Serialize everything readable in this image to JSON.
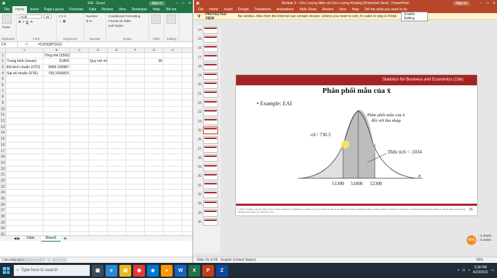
{
  "excel": {
    "title": "EAI - Excel",
    "signin": "Sign in",
    "tabs": [
      "File",
      "Home",
      "Insert",
      "Page Layout",
      "Formulas",
      "Data",
      "Review",
      "View",
      "Developer",
      "Help",
      "Tell me"
    ],
    "ribbon": {
      "paste": "Paste",
      "clipboard": "Clipboard",
      "font_name": "Arial",
      "font_size": "10",
      "font_group": "Font",
      "alignment": "Alignment",
      "number_format": "Number",
      "number_group": "Number",
      "conditional": "Conditional Formatting",
      "format_table": "Format as Table",
      "cell_styles": "Cell Styles",
      "styles_group": "Styles",
      "cells": "Cells",
      "editing": "Editing"
    },
    "namebox": "C4",
    "formula": "=C3/SQRT(G2)",
    "fx": "fx",
    "columns": [
      "A",
      "B",
      "C",
      "D",
      "E",
      "F",
      "G",
      "H"
    ],
    "rows": [
      [
        "1",
        "",
        "Tổng thể (2500)",
        "",
        "",
        "",
        "",
        "",
        ""
      ],
      [
        "2",
        "Trung bình (mean)",
        "51800",
        "",
        "Quy mô mẫu",
        "",
        "",
        "30",
        ""
      ],
      [
        "3",
        "Độ lệch chuẩn (STD)",
        "3999.199987",
        "",
        "",
        "",
        "",
        "",
        ""
      ],
      [
        "4",
        "Sai số chuẩn (STE)",
        "730.1506815",
        "",
        "",
        "",
        "",
        "",
        ""
      ],
      [
        "5",
        "",
        "",
        "",
        "",
        "",
        "",
        "",
        ""
      ],
      [
        "6",
        "",
        "",
        "",
        "",
        "",
        "",
        "",
        ""
      ],
      [
        "7",
        "",
        "",
        "",
        "",
        "",
        "",
        "",
        ""
      ],
      [
        "8",
        "",
        "",
        "",
        "",
        "",
        "",
        "",
        ""
      ],
      [
        "9",
        "",
        "",
        "",
        "",
        "",
        "",
        "",
        ""
      ],
      [
        "10",
        "",
        "",
        "",
        "",
        "",
        "",
        "",
        ""
      ],
      [
        "11",
        "",
        "",
        "",
        "",
        "",
        "",
        "",
        ""
      ],
      [
        "12",
        "",
        "",
        "",
        "",
        "",
        "",
        "",
        ""
      ],
      [
        "13",
        "",
        "",
        "",
        "",
        "",
        "",
        "",
        ""
      ],
      [
        "14",
        "",
        "",
        "",
        "",
        "",
        "",
        "",
        ""
      ],
      [
        "15",
        "",
        "",
        "",
        "",
        "",
        "",
        "",
        ""
      ],
      [
        "16",
        "",
        "",
        "",
        "",
        "",
        "",
        "",
        ""
      ],
      [
        "17",
        "",
        "",
        "",
        "",
        "",
        "",
        "",
        ""
      ],
      [
        "18",
        "",
        "",
        "",
        "",
        "",
        "",
        "",
        ""
      ],
      [
        "19",
        "",
        "",
        "",
        "",
        "",
        "",
        "",
        ""
      ],
      [
        "20",
        "",
        "",
        "",
        "",
        "",
        "",
        "",
        ""
      ],
      [
        "21",
        "",
        "",
        "",
        "",
        "",
        "",
        "",
        ""
      ],
      [
        "22",
        "",
        "",
        "",
        "",
        "",
        "",
        "",
        ""
      ],
      [
        "23",
        "",
        "",
        "",
        "",
        "",
        "",
        "",
        ""
      ],
      [
        "24",
        "",
        "",
        "",
        "",
        "",
        "",
        "",
        ""
      ],
      [
        "25",
        "",
        "",
        "",
        "",
        "",
        "",
        "",
        ""
      ],
      [
        "26",
        "",
        "",
        "",
        "",
        "",
        "",
        "",
        ""
      ],
      [
        "27",
        "",
        "",
        "",
        "",
        "",
        "",
        "",
        ""
      ],
      [
        "28",
        "",
        "",
        "",
        "",
        "",
        "",
        "",
        ""
      ],
      [
        "29",
        "",
        "",
        "",
        "",
        "",
        "",
        "",
        ""
      ],
      [
        "30",
        "",
        "",
        "",
        "",
        "",
        "",
        "",
        ""
      ],
      [
        "31",
        "",
        "",
        "",
        "",
        "",
        "",
        "",
        ""
      ]
    ],
    "sheets": [
      "Data",
      "Sheet1"
    ],
    "status": "Calculate with"
  },
  "ppt": {
    "title": "Module 3 - Ước Lượng điểm và Ước Lượng Khoảng [Protected View] - PowerPoint",
    "signin": "Sign in",
    "tabs": [
      "File",
      "Home",
      "Insert",
      "Design",
      "Transitions",
      "Animations",
      "Slide Show",
      "Review",
      "View",
      "Help",
      "Tell me what you want to do"
    ],
    "protected_title": "PROTECTED VIEW",
    "protected_msg": "Be careful—files from the Internet can contain viruses. Unless you need to edit, it's safer to stay in Protected View.",
    "enable_btn": "Enable Editing",
    "thumbs": [
      "14",
      "15",
      "16",
      "17",
      "18",
      "19",
      "20",
      "21",
      "22",
      "23",
      "24",
      "25",
      "26",
      "27",
      "28",
      "29",
      "30",
      "31",
      "32",
      "33",
      "34",
      "35"
    ],
    "active_thumb": "25",
    "slide": {
      "banner": "Statistics for Business and Economics (13e)",
      "title": "Phân phối mẫu của x̄",
      "bullet": "Example:  EAI",
      "dist_label_1": "Phân phối mẫu của x̄",
      "dist_label_2": "đối với thu nhập",
      "sigma": "σx̄= 730.3",
      "area": "Diện tích = .5034",
      "x_labels": [
        "51300",
        "51800",
        "52300"
      ],
      "x_axis": "x̄",
      "footnote": "© 2017 Cengage Learning. May not be copied, scanned, or duplicated, in whole or in part, except for use as permitted in a license distributed with a certain product or service or otherwise on a password-protected website or school-approved learning management system for classroom use.",
      "page": "25"
    },
    "status_slide": "Slide 25 of 65",
    "status_lang": "English (United States)",
    "zoom": "59%",
    "net_percent": "45%",
    "net_up": "↑ 0.4KB/s",
    "net_down": "↓ 0.1KB/s"
  },
  "taskbar": {
    "search_placeholder": "Type here to search",
    "watermark": "SCREENCAST O MATIC",
    "time": "3:39 PM",
    "date": "4/23/2021"
  }
}
